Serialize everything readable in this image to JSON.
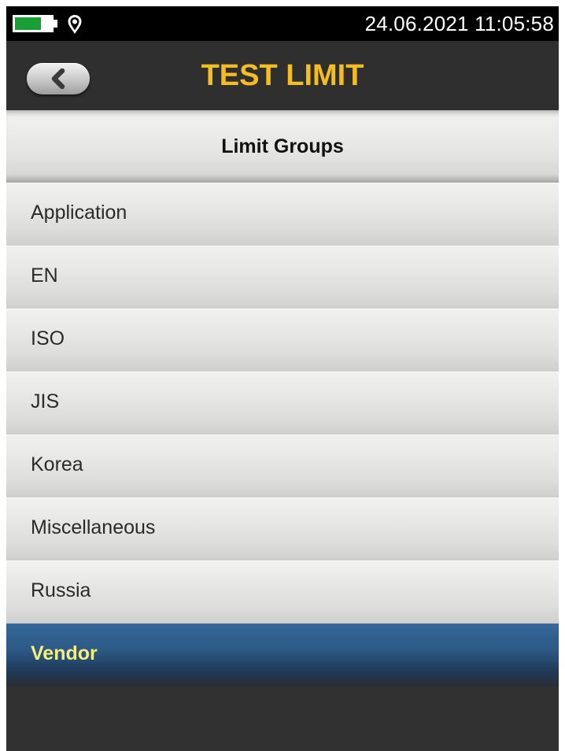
{
  "status": {
    "battery_level": 0.72,
    "datetime": "24.06.2021 11:05:58",
    "colors": {
      "battery": "#17a033",
      "text": "#ffffff"
    },
    "icons": [
      "battery-icon",
      "location-pin-icon"
    ]
  },
  "header": {
    "title": "TEST LIMIT",
    "back_icon": "chevron-left-icon",
    "title_color": "#f5bd1e"
  },
  "section": {
    "title": "Limit Groups"
  },
  "groups": [
    {
      "label": "Application",
      "selected": false
    },
    {
      "label": "EN",
      "selected": false
    },
    {
      "label": "ISO",
      "selected": false
    },
    {
      "label": "JIS",
      "selected": false
    },
    {
      "label": "Korea",
      "selected": false
    },
    {
      "label": "Miscellaneous",
      "selected": false
    },
    {
      "label": "Russia",
      "selected": false
    },
    {
      "label": "Vendor",
      "selected": true
    }
  ],
  "colors": {
    "selected_text": "#f4ef7c",
    "selected_background": "#2d5a86",
    "background": "#313131"
  }
}
